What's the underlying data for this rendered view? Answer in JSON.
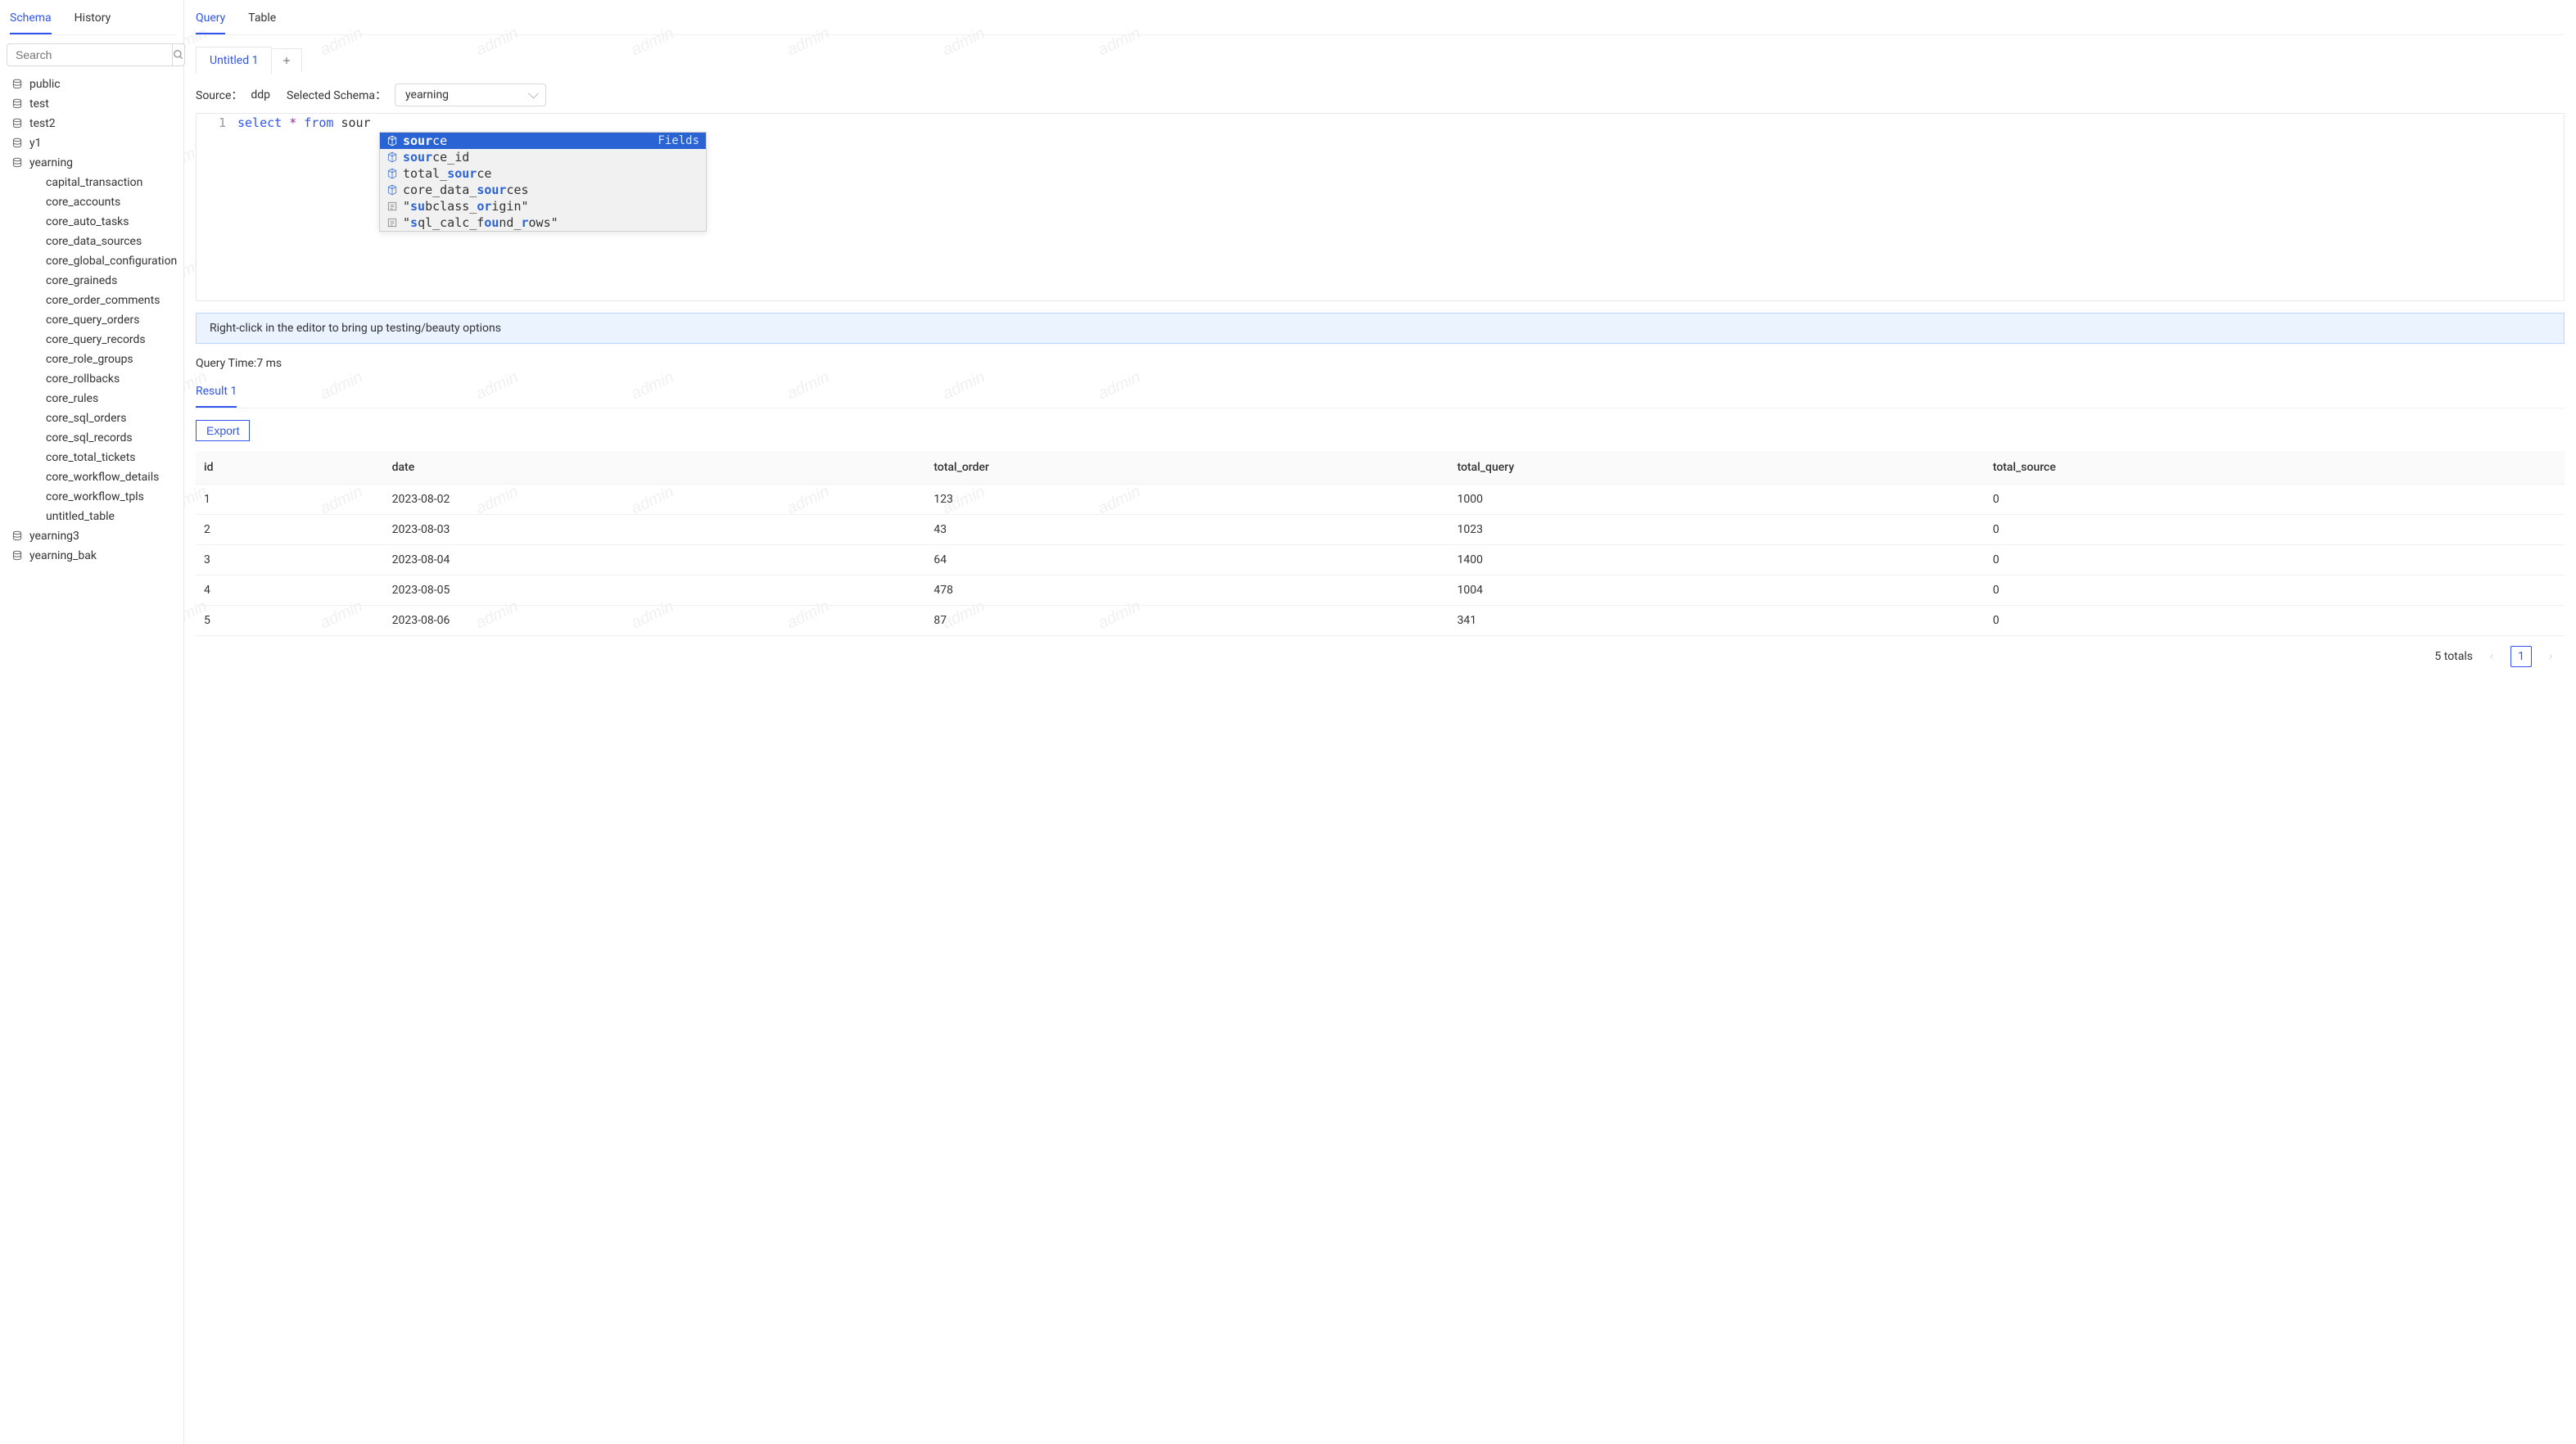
{
  "watermark_text": "admin",
  "sidebar": {
    "tabs": {
      "schema": "Schema",
      "history": "History"
    },
    "search_placeholder": "Search",
    "databases": [
      {
        "name": "public",
        "children": []
      },
      {
        "name": "test",
        "children": []
      },
      {
        "name": "test2",
        "children": []
      },
      {
        "name": "y1",
        "children": []
      },
      {
        "name": "yearning",
        "children": [
          "capital_transaction",
          "core_accounts",
          "core_auto_tasks",
          "core_data_sources",
          "core_global_configuration",
          "core_graineds",
          "core_order_comments",
          "core_query_orders",
          "core_query_records",
          "core_role_groups",
          "core_rollbacks",
          "core_rules",
          "core_sql_orders",
          "core_sql_records",
          "core_total_tickets",
          "core_workflow_details",
          "core_workflow_tpls",
          "untitled_table"
        ]
      },
      {
        "name": "yearning3",
        "children": []
      },
      {
        "name": "yearning_bak",
        "children": []
      }
    ]
  },
  "main": {
    "tabs": {
      "query": "Query",
      "table": "Table"
    },
    "query_tab_label": "Untitled 1",
    "source_label": "Source：",
    "source_value": "ddp",
    "schema_label": "Selected Schema：",
    "schema_value": "yearning",
    "editor": {
      "line_number": "1",
      "tokens": {
        "select": "select",
        "star": "*",
        "from": "from",
        "partial": "sour"
      }
    },
    "autocomplete": {
      "hint": "Fields",
      "items": [
        {
          "kind": "field",
          "display": [
            [
              "b",
              "sour"
            ],
            [
              "",
              "ce"
            ]
          ]
        },
        {
          "kind": "field",
          "display": [
            [
              "b",
              "sour"
            ],
            [
              "",
              "ce_id"
            ]
          ]
        },
        {
          "kind": "field",
          "display": [
            [
              "",
              "total_"
            ],
            [
              "b",
              "sour"
            ],
            [
              "",
              "ce"
            ]
          ]
        },
        {
          "kind": "field",
          "display": [
            [
              "",
              "core_data_"
            ],
            [
              "b",
              "sour"
            ],
            [
              "",
              "ces"
            ]
          ]
        },
        {
          "kind": "text",
          "display": [
            [
              "",
              "\""
            ],
            [
              "b",
              "su"
            ],
            [
              "",
              "bclass_"
            ],
            [
              "b",
              "or"
            ],
            [
              "",
              "igin\""
            ]
          ]
        },
        {
          "kind": "text",
          "display": [
            [
              "",
              "\""
            ],
            [
              "b",
              "s"
            ],
            [
              "",
              "ql_calc_f"
            ],
            [
              "b",
              "ou"
            ],
            [
              "",
              "nd_"
            ],
            [
              "b",
              "r"
            ],
            [
              "",
              "ows\""
            ]
          ]
        }
      ]
    },
    "banner": "Right-click in the editor to bring up testing/beauty options",
    "query_time": "Query Time:7 ms",
    "result_tab": "Result 1",
    "export_label": "Export",
    "columns": [
      "id",
      "date",
      "total_order",
      "total_query",
      "total_source"
    ],
    "rows": [
      {
        "id": "1",
        "date": "2023-08-02",
        "total_order": "123",
        "total_query": "1000",
        "total_source": "0"
      },
      {
        "id": "2",
        "date": "2023-08-03",
        "total_order": "43",
        "total_query": "1023",
        "total_source": "0"
      },
      {
        "id": "3",
        "date": "2023-08-04",
        "total_order": "64",
        "total_query": "1400",
        "total_source": "0"
      },
      {
        "id": "4",
        "date": "2023-08-05",
        "total_order": "478",
        "total_query": "1004",
        "total_source": "0"
      },
      {
        "id": "5",
        "date": "2023-08-06",
        "total_order": "87",
        "total_query": "341",
        "total_source": "0"
      }
    ],
    "totals_label": "5 totals",
    "page_number": "1"
  }
}
